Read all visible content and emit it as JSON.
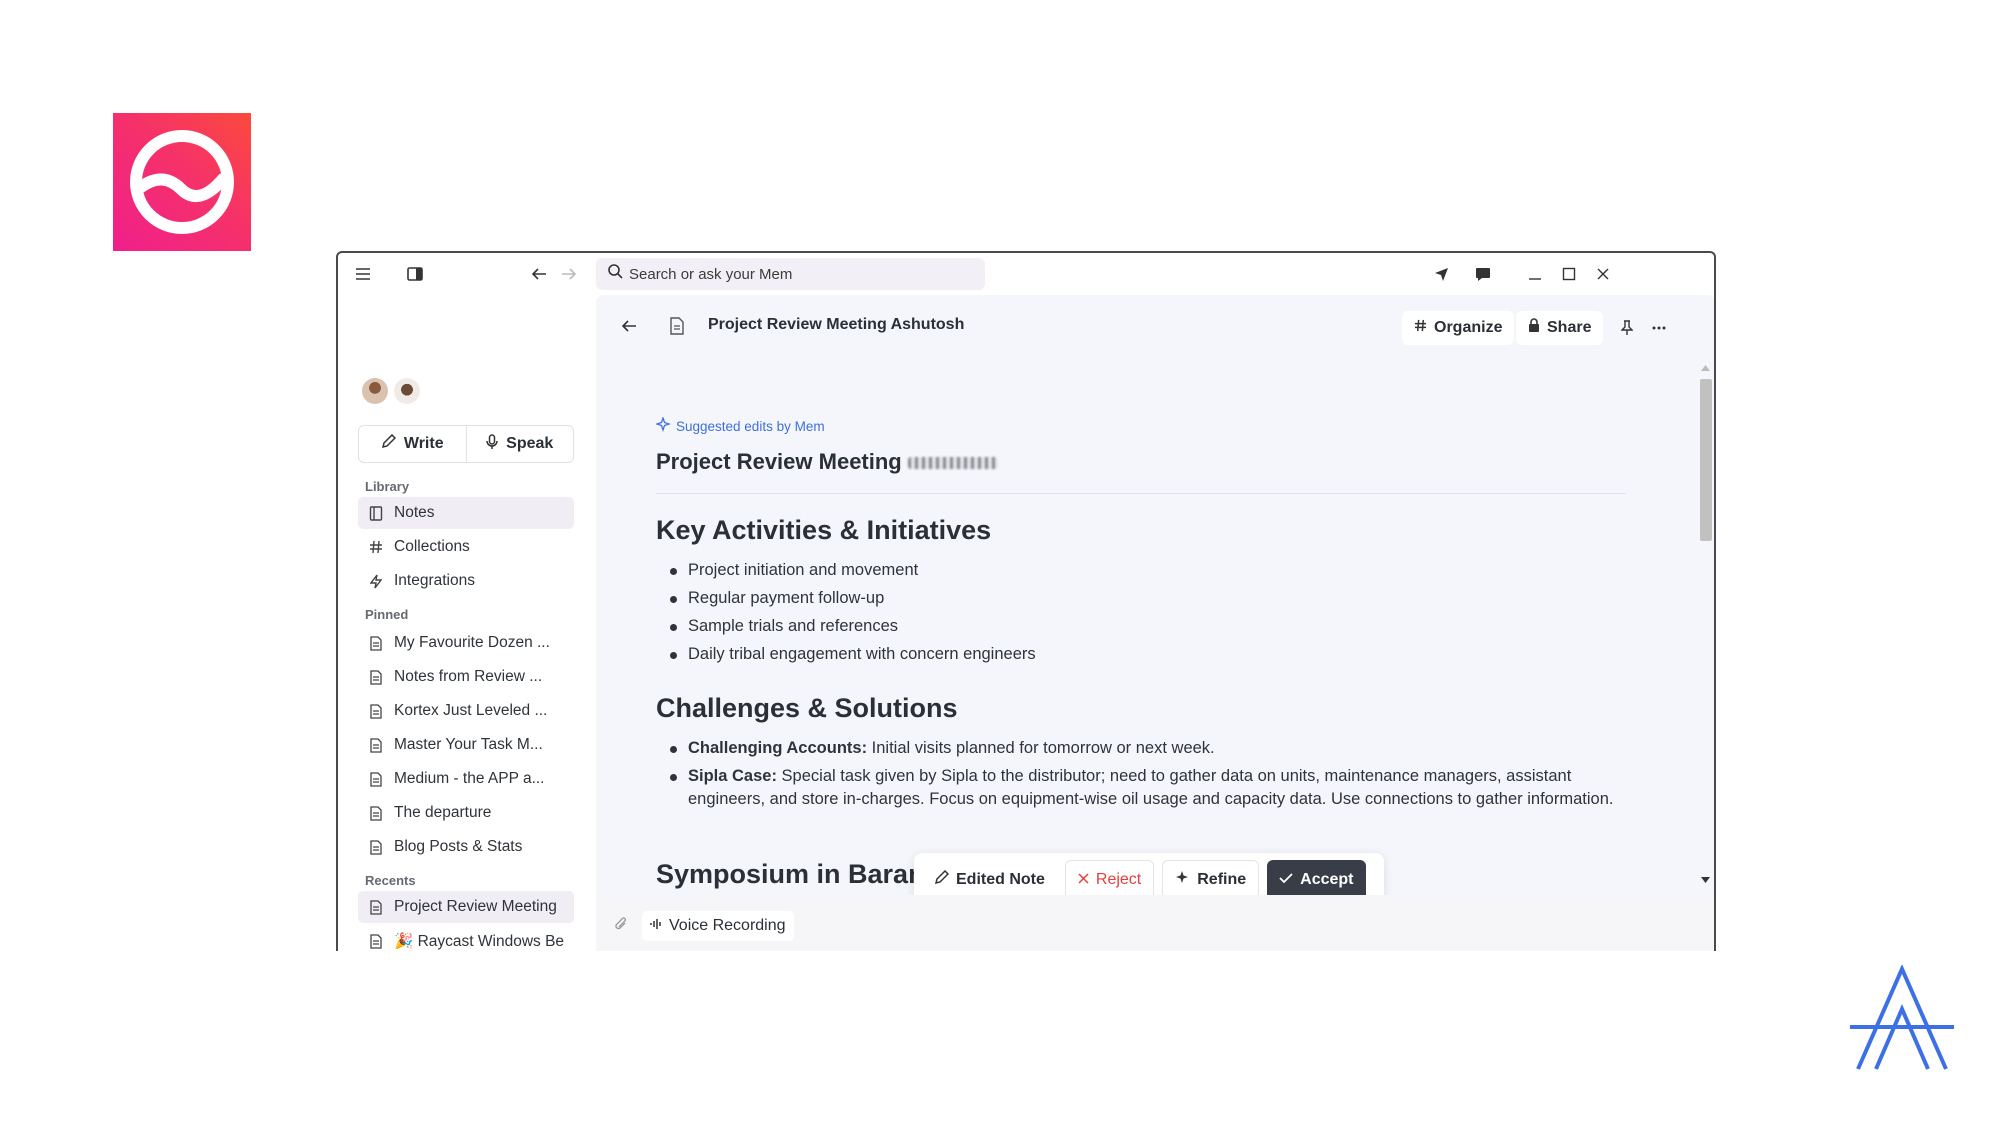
{
  "search": {
    "placeholder": "Search or ask your Mem"
  },
  "sidebar": {
    "write_label": "Write",
    "speak_label": "Speak",
    "library_heading": "Library",
    "library": [
      {
        "label": "Notes",
        "icon": "notebook-icon",
        "active": true
      },
      {
        "label": "Collections",
        "icon": "hash-icon"
      },
      {
        "label": "Integrations",
        "icon": "bolt-icon"
      }
    ],
    "pinned_heading": "Pinned",
    "pinned": [
      {
        "label": "My Favourite Dozen ..."
      },
      {
        "label": "Notes from Review ..."
      },
      {
        "label": "Kortex Just Leveled ..."
      },
      {
        "label": "Master Your Task M..."
      },
      {
        "label": "Medium - the APP a..."
      },
      {
        "label": "The departure"
      },
      {
        "label": "Blog Posts & Stats"
      }
    ],
    "recents_heading": "Recents",
    "recents": [
      {
        "label": "Project Review Meeting",
        "active": true
      },
      {
        "label": "🎉 Raycast Windows Be"
      }
    ]
  },
  "header": {
    "title": "Project Review Meeting Ashutosh",
    "organize_label": "Organize",
    "share_label": "Share"
  },
  "document": {
    "suggested_label": "Suggested edits by Mem",
    "title": "Project Review Meeting",
    "section1": {
      "heading": "Key Activities & Initiatives",
      "items": [
        "Project initiation and movement",
        "Regular payment follow-up",
        "Sample trials and references",
        "Daily tribal engagement with concern engineers"
      ]
    },
    "section2": {
      "heading": "Challenges & Solutions",
      "items": [
        {
          "bold": "Challenging Accounts:",
          "text": " Initial visits planned for tomorrow or next week."
        },
        {
          "bold": "Sipla Case:",
          "text": " Special task given by Sipla to the distributor; need to gather data on units, maintenance managers, assistant engineers, and store in-charges. Focus on equipment-wise oil usage and capacity data. Use connections to gather information."
        }
      ]
    },
    "section3": {
      "heading": "Symposium in Baramati (December/January/February)"
    }
  },
  "edit_bar": {
    "edited_label": "Edited Note",
    "reject_label": "Reject",
    "refine_label": "Refine",
    "accept_label": "Accept"
  },
  "bottom": {
    "voice_label": "Voice Recording"
  },
  "colors": {
    "brand_gradient_start": "#f01f8c",
    "brand_gradient_end": "#fb4a3c",
    "accent_blue": "#3f6fd9",
    "reject_red": "#e5403f",
    "accept_dark": "#383d47",
    "main_bg": "#f4f6fc"
  }
}
